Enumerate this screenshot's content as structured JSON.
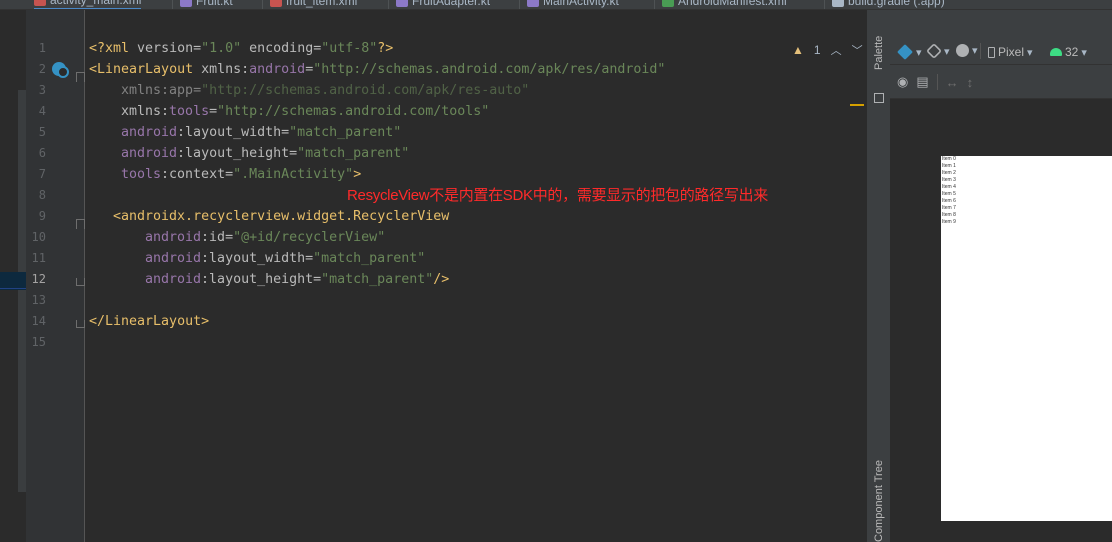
{
  "tabs": [
    {
      "label": "activity_main.xml",
      "icon": "xml-layout-icon",
      "color": "#c75450",
      "active": true
    },
    {
      "label": "Fruit.kt",
      "icon": "kotlin-icon",
      "color": "#8c79c8"
    },
    {
      "label": "fruit_item.xml",
      "icon": "xml-layout-icon",
      "color": "#c75450"
    },
    {
      "label": "FruitAdapter.kt",
      "icon": "kotlin-icon",
      "color": "#8c79c8"
    },
    {
      "label": "MainActivity.kt",
      "icon": "kotlin-icon",
      "color": "#8c79c8"
    },
    {
      "label": "AndroidManifest.xml",
      "icon": "manifest-icon",
      "color": "#499c54"
    },
    {
      "label": "build.gradle (:app)",
      "icon": "gradle-icon",
      "color": "#a9b7c6"
    }
  ],
  "editor": {
    "line_numbers": [
      "1",
      "2",
      "3",
      "4",
      "5",
      "6",
      "7",
      "8",
      "9",
      "10",
      "11",
      "12",
      "13",
      "14",
      "15"
    ],
    "lines": {
      "l1": {
        "p1": "<?",
        "t": "xml ",
        "a1": "version",
        "eq1": "=",
        "v1": "\"1.0\"",
        "sp": " ",
        "a2": "encoding",
        "eq2": "=",
        "v2": "\"utf-8\"",
        "p2": "?>"
      },
      "l2": {
        "p1": "<",
        "t": "LinearLayout ",
        "a": "xmlns:",
        "ns": "android",
        "eq": "=",
        "v": "\"http://schemas.android.com/apk/res/android\""
      },
      "l3": {
        "a": "xmlns:app",
        "eq": "=",
        "v": "\"http://schemas.android.com/apk/res-auto\""
      },
      "l4": {
        "a": "xmlns:",
        "ns": "tools",
        "eq": "=",
        "v": "\"http://schemas.android.com/tools\""
      },
      "l5": {
        "ns": "android",
        "a": ":layout_width",
        "eq": "=",
        "v": "\"match_parent\""
      },
      "l6": {
        "ns": "android",
        "a": ":layout_height",
        "eq": "=",
        "v": "\"match_parent\""
      },
      "l7": {
        "ns": "tools",
        "a": ":context",
        "eq": "=",
        "v": "\".MainActivity\"",
        "p": ">"
      },
      "l9": {
        "p": "<",
        "t": "androidx.recyclerview.widget.RecyclerView"
      },
      "l10": {
        "ns": "android",
        "a": ":id",
        "eq": "=",
        "v": "\"@+id/recyclerView\""
      },
      "l11": {
        "ns": "android",
        "a": ":layout_width",
        "eq": "=",
        "v": "\"match_parent\""
      },
      "l12": {
        "ns": "android",
        "a": ":layout_height",
        "eq": "=",
        "v": "\"match_parent\"",
        "p": "/>"
      },
      "l14": {
        "p1": "</",
        "t": "LinearLayout",
        "p2": ">"
      }
    },
    "annotation": "ResycleView不是内置在SDK中的，需要显示的把包的路径写出来",
    "inspection": {
      "warning_count": "1"
    }
  },
  "side_labels": {
    "palette": "Palette",
    "component_tree": "Component Tree"
  },
  "design": {
    "device": "Pixel",
    "api": "32",
    "items": [
      "Item 0",
      "Item 1",
      "Item 2",
      "Item 3",
      "Item 4",
      "Item 5",
      "Item 6",
      "Item 7",
      "Item 8",
      "Item 9"
    ]
  }
}
